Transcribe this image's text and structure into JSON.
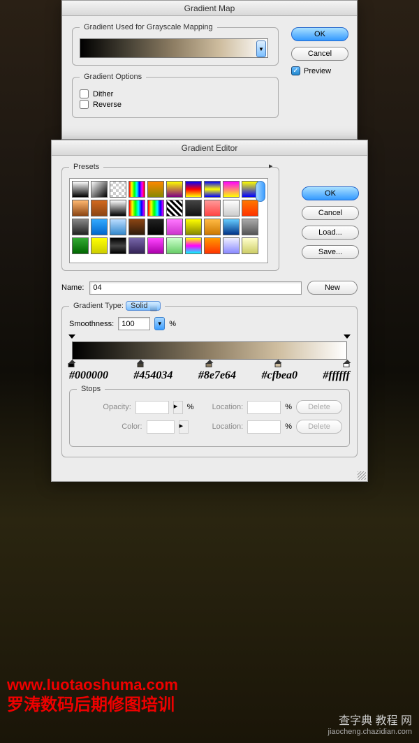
{
  "gradientMap": {
    "title": "Gradient Map",
    "usedFieldset": "Gradient Used for Grayscale Mapping",
    "optionsFieldset": "Gradient Options",
    "ditherLabel": "Dither",
    "reverseLabel": "Reverse",
    "okLabel": "OK",
    "cancelLabel": "Cancel",
    "previewLabel": "Preview"
  },
  "gradientEditor": {
    "title": "Gradient Editor",
    "presetsLabel": "Presets",
    "okLabel": "OK",
    "cancelLabel": "Cancel",
    "loadLabel": "Load...",
    "saveLabel": "Save...",
    "nameLabel": "Name:",
    "nameValue": "04",
    "newLabel": "New",
    "gradientTypeLabel": "Gradient Type:",
    "gradientTypeValue": "Solid",
    "smoothnessLabel": "Smoothness:",
    "smoothnessValue": "100",
    "percent": "%",
    "stopsLabel": "Stops",
    "opacityLabel": "Opacity:",
    "colorLabel": "Color:",
    "locationLabel": "Location:",
    "deleteLabel": "Delete"
  },
  "gradientStops": [
    {
      "pos": 0,
      "hex": "#000000"
    },
    {
      "pos": 25,
      "hex": "#454034"
    },
    {
      "pos": 50,
      "hex": "#8e7e64"
    },
    {
      "pos": 75,
      "hex": "#cfbea0"
    },
    {
      "pos": 100,
      "hex": "#ffffff"
    }
  ],
  "opacityStops": [
    {
      "pos": 0
    },
    {
      "pos": 100
    }
  ],
  "presets": [
    "linear-gradient(to bottom,#fff,#000)",
    "linear-gradient(to bottom right,#fff,#000)",
    "repeating-conic-gradient(#ccc 0 25%,#fff 0 50%) 0/8px 8px",
    "linear-gradient(to right,#f00,#ff0,#0f0,#0ff,#00f,#f0f,#f00)",
    "linear-gradient(to bottom,#f80,#880)",
    "linear-gradient(to bottom,#ff0,#800080)",
    "linear-gradient(to bottom,#00f,#f00,#ff0)",
    "linear-gradient(to bottom,#00f,#ff0,#00f)",
    "linear-gradient(to bottom,#f0f,#ff0)",
    "linear-gradient(to bottom,#ff0,#00f)",
    "linear-gradient(to bottom,#ffb870,#8b4513)",
    "linear-gradient(to bottom,#d2691e,#8b4513)",
    "linear-gradient(to bottom,#fff,#000)",
    "linear-gradient(to right,#f00,#ff0,#0f0,#0ff,#00f,#f0f)",
    "linear-gradient(to right,#f00,#ff0,#0f0,#0ff,#00f,#f0f)",
    "repeating-linear-gradient(45deg,#000 0 3px,#fff 3px 6px)",
    "linear-gradient(to bottom,#444,#111)",
    "linear-gradient(to bottom,#f99,#f44)",
    "linear-gradient(to bottom,#fff,#ccc)",
    "linear-gradient(to bottom,#f70,#f30)",
    "linear-gradient(to bottom,#888,#222)",
    "linear-gradient(to bottom,#3af,#06c)",
    "linear-gradient(to bottom,#bdf,#38c)",
    "linear-gradient(to bottom,#8b4513,#2f1b0c)",
    "linear-gradient(to bottom,#222,#000)",
    "linear-gradient(to bottom,#f7f,#c3c)",
    "linear-gradient(to bottom,#ff0,#880)",
    "linear-gradient(to bottom,#fb4,#c70)",
    "linear-gradient(to bottom,#6cf,#038)",
    "linear-gradient(to bottom,#aaa,#555)",
    "linear-gradient(to bottom,#3a3,#060)",
    "linear-gradient(to bottom,#ff0,#cc0)",
    "linear-gradient(to bottom,#000,#444,#000)",
    "linear-gradient(to bottom,#76a,#325)",
    "linear-gradient(to bottom,#f4f,#a0a)",
    "linear-gradient(to bottom,#cfc,#6c6)",
    "linear-gradient(to bottom,#ff0,#f0f,#0ff)",
    "linear-gradient(to bottom,#f90,#f30)",
    "linear-gradient(to bottom,#eef,#88f)",
    "linear-gradient(to bottom,#ffc,#cc6)"
  ],
  "watermark": {
    "url": "www.luotaoshuma.com",
    "cn": "罗涛数码后期修图培训",
    "brand": "查字典 教程 网",
    "sub": "jiaocheng.chazidian.com"
  }
}
